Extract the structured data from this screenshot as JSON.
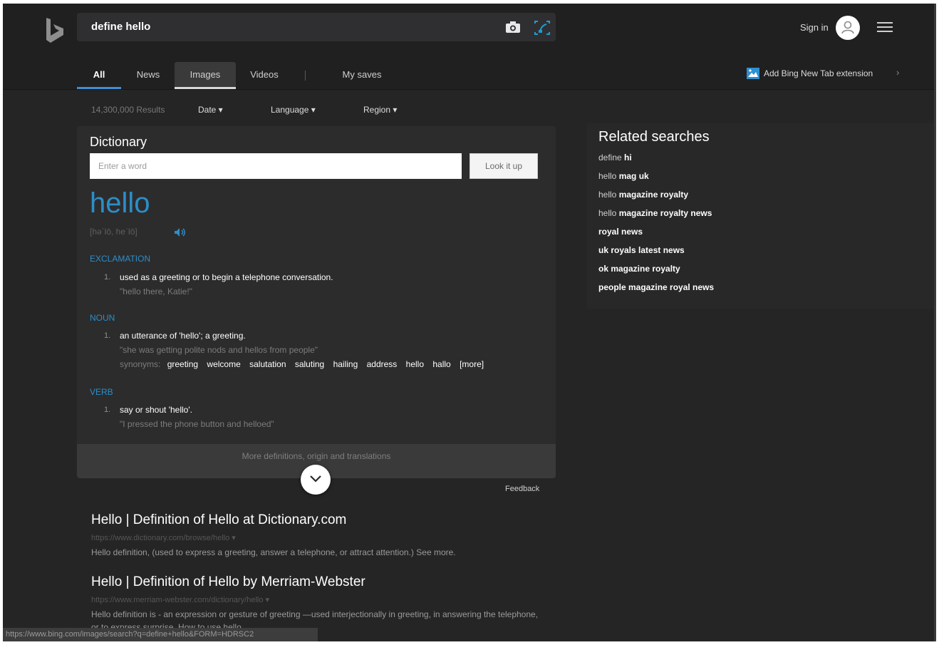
{
  "search": {
    "query": "define hello"
  },
  "header": {
    "sign_in": "Sign in",
    "extension_label": "Add Bing New Tab extension",
    "extension_chevron": "›"
  },
  "tabs": [
    {
      "label": "All",
      "active": true
    },
    {
      "label": "News"
    },
    {
      "label": "Images",
      "hover": true
    },
    {
      "label": "Videos"
    },
    {
      "label": "My saves"
    }
  ],
  "filters": {
    "results_count": "14,300,000 Results",
    "date": "Date ▾",
    "language": "Language ▾",
    "region": "Region ▾"
  },
  "dictionary": {
    "title": "Dictionary",
    "input_placeholder": "Enter a word",
    "lookup_label": "Look it up",
    "headword": "hello",
    "pronunciation": "[həˈlō, heˈlō]",
    "exclamation_label": "EXCLAMATION",
    "def1_num": "1.",
    "def1_text": "used as a greeting or to begin a telephone conversation.",
    "def1_example": "\"hello there, Katie!\"",
    "noun_label": "NOUN",
    "def2_num": "1.",
    "def2_text": "an utterance of 'hello'; a greeting.",
    "def2_example": "\"she was getting polite nods and hellos from people\"",
    "synonyms_label": "synonyms:",
    "synonyms": [
      "greeting",
      "welcome",
      "salutation",
      "saluting",
      "hailing",
      "address",
      "hello",
      "hallo",
      "[more]"
    ],
    "verb_label": "VERB",
    "def3_num": "1.",
    "def3_text": "say or shout 'hello'.",
    "def3_example": "\"I pressed the phone button and helloed\"",
    "more_link": "More definitions, origin and translations",
    "feedback": "Feedback"
  },
  "related": {
    "title": "Related searches",
    "items": [
      {
        "norm": "define ",
        "bold": "hi"
      },
      {
        "norm": "hello ",
        "bold": "mag uk"
      },
      {
        "norm": "hello ",
        "bold": "magazine royalty"
      },
      {
        "norm": "hello ",
        "bold": "magazine royalty news"
      },
      {
        "norm": "",
        "bold": "royal news"
      },
      {
        "norm": "",
        "bold": "uk royals latest news"
      },
      {
        "norm": "",
        "bold": "ok magazine royalty"
      },
      {
        "norm": "",
        "bold": "people magazine royal news"
      }
    ]
  },
  "results": [
    {
      "title": "Hello | Definition of Hello at Dictionary.com",
      "url": "https://www.dictionary.com/browse/hello ▾",
      "snippet": "Hello definition, (used to express a greeting, answer a telephone, or attract attention.) See more."
    },
    {
      "title": "Hello | Definition of Hello by Merriam-Webster",
      "url": "https://www.merriam-webster.com/dictionary/hello ▾",
      "snippet": "Hello definition is - an expression or gesture of greeting —used interjectionally in greeting, in answering the telephone, or to express surprise. How to use hello..."
    }
  ],
  "status_bar": "https://www.bing.com/images/search?q=define+hello&FORM=HDRSC2",
  "colors": {
    "accent": "#2c8ec8",
    "background": "#252526",
    "header": "#202021"
  },
  "icons": [
    "bing-logo",
    "camera-icon",
    "visual-search-icon",
    "avatar-icon",
    "hamburger-menu-icon",
    "extension-icon",
    "speaker-icon",
    "chevron-down-icon"
  ]
}
